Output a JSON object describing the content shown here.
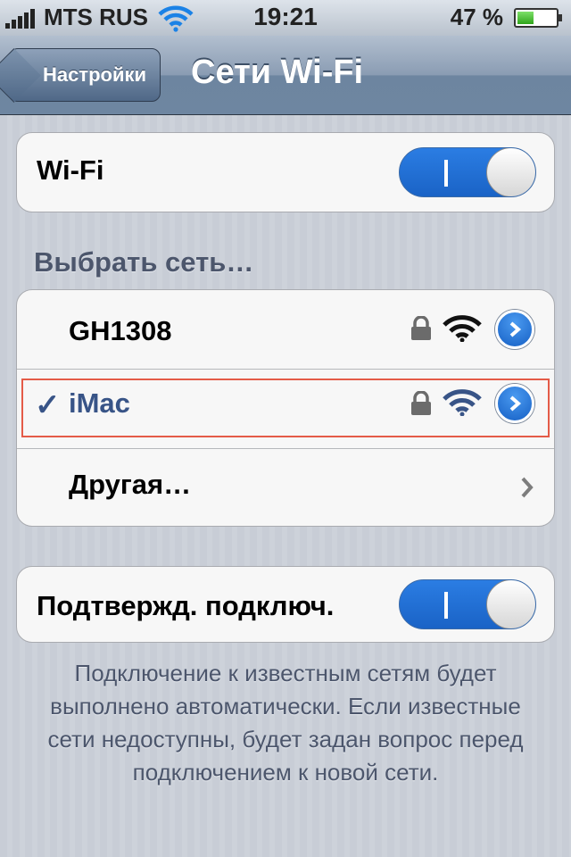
{
  "status_bar": {
    "carrier": "MTS RUS",
    "time": "19:21",
    "battery_percent": "47 %",
    "battery_level": 0.47,
    "icons": [
      "signal-bars-icon",
      "wifi-icon",
      "battery-icon"
    ]
  },
  "nav": {
    "back_label": "Настройки",
    "title": "Сети Wi-Fi"
  },
  "wifi_group": {
    "label": "Wi-Fi",
    "toggle_on": true
  },
  "networks_header": "Выбрать сеть…",
  "networks": [
    {
      "name": "GH1308",
      "locked": true,
      "selected": false
    },
    {
      "name": "iMac",
      "locked": true,
      "selected": true,
      "check": "✓"
    },
    {
      "name": "Другая…",
      "other": true
    }
  ],
  "ask_join": {
    "label": "Подтвержд. подключ.",
    "toggle_on": true
  },
  "footer": "Подключение к известным сетям будет выполнено автоматически. Если известные сети недоступны, будет задан вопрос перед подключением к новой сети.",
  "colors": {
    "accent_blue": "#1a63c6",
    "selected_text": "#385487",
    "header_text": "#4c566c",
    "highlight_frame": "#e45b48"
  }
}
